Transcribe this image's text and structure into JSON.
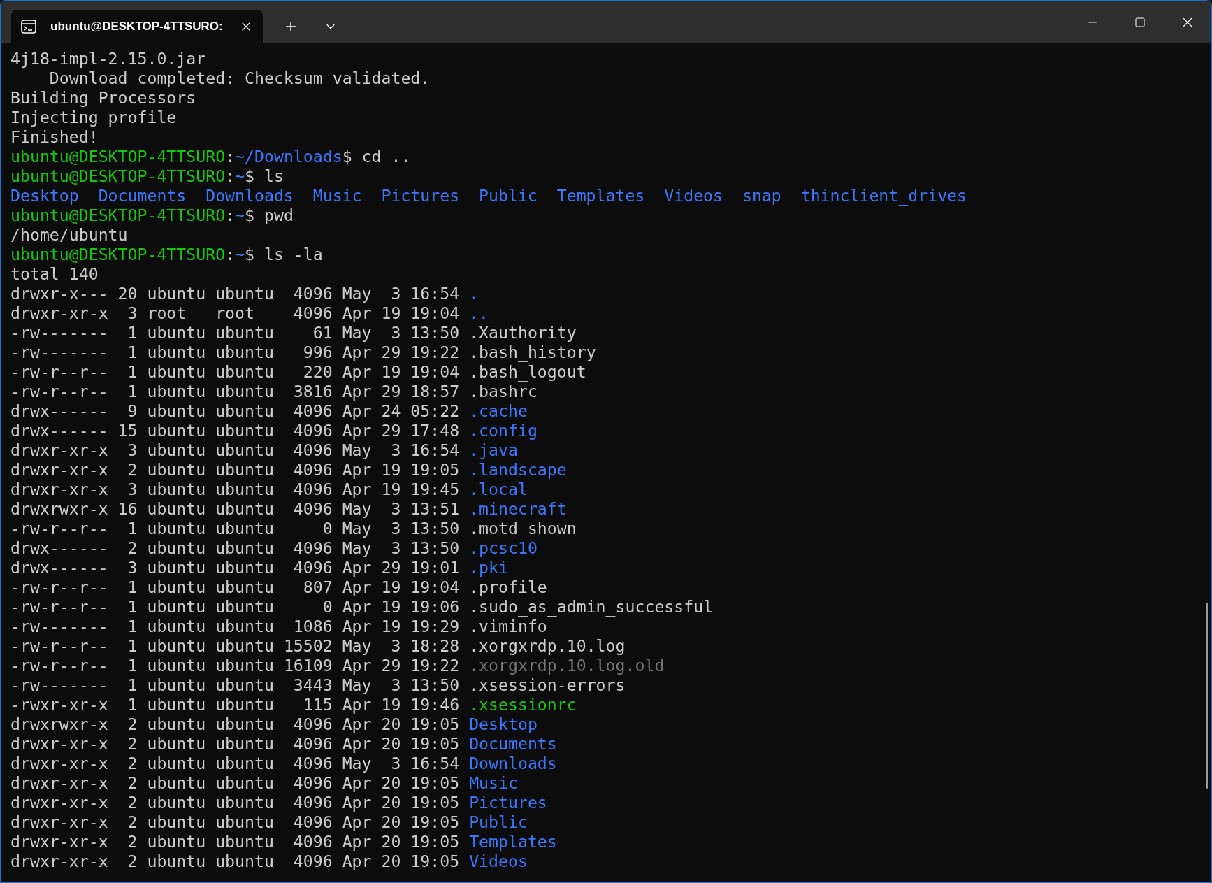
{
  "window": {
    "tabs": [
      {
        "title": "ubuntu@DESKTOP-4TTSURO:",
        "selected": true
      }
    ]
  },
  "terminal": {
    "lines": [
      {
        "kind": "output",
        "text": "4j18-impl-2.15.0.jar"
      },
      {
        "kind": "output",
        "text": "Download completed: Checksum validated.",
        "indented": true
      },
      {
        "kind": "output",
        "text": "Building Processors"
      },
      {
        "kind": "output",
        "text": "Injecting profile"
      },
      {
        "kind": "output",
        "text": "Finished!"
      },
      {
        "kind": "prompt",
        "user": "ubuntu@DESKTOP-4TTSURO",
        "separator": ":",
        "path": "~/Downloads",
        "command": "$ cd .."
      },
      {
        "kind": "prompt",
        "user": "ubuntu@DESKTOP-4TTSURO",
        "separator": ":",
        "path": "~",
        "command": "$ ls"
      },
      {
        "kind": "columns",
        "items": [
          "Desktop",
          "Documents",
          "Downloads",
          "Music",
          "Pictures",
          "Public",
          "Templates",
          "Videos",
          "snap",
          "thinclient_drives"
        ]
      },
      {
        "kind": "prompt",
        "user": "ubuntu@DESKTOP-4TTSURO",
        "separator": ":",
        "path": "~",
        "command": "$ pwd"
      },
      {
        "kind": "output",
        "text": "/home/ubuntu"
      },
      {
        "kind": "prompt",
        "user": "ubuntu@DESKTOP-4TTSURO",
        "separator": ":",
        "path": "~",
        "command": "$ ls -la"
      },
      {
        "kind": "output",
        "text": "total 140"
      },
      {
        "kind": "dir",
        "info": "drwxr-x--- 20 ubuntu ubuntu  4096 May  3 16:54",
        "name": "."
      },
      {
        "kind": "dir",
        "info": "drwxr-xr-x  3 root   root    4096 Apr 19 19:04",
        "name": ".."
      },
      {
        "kind": "file",
        "info": "-rw-------  1 ubuntu ubuntu    61 May  3 13:50",
        "name": ".Xauthority"
      },
      {
        "kind": "file",
        "info": "-rw-------  1 ubuntu ubuntu   996 Apr 29 19:22",
        "name": ".bash_history"
      },
      {
        "kind": "file",
        "info": "-rw-r--r--  1 ubuntu ubuntu   220 Apr 19 19:04",
        "name": ".bash_logout"
      },
      {
        "kind": "file",
        "info": "-rw-r--r--  1 ubuntu ubuntu  3816 Apr 29 18:57",
        "name": ".bashrc"
      },
      {
        "kind": "dir",
        "info": "drwx------  9 ubuntu ubuntu  4096 Apr 24 05:22",
        "name": ".cache"
      },
      {
        "kind": "dir",
        "info": "drwx------ 15 ubuntu ubuntu  4096 Apr 29 17:48",
        "name": ".config"
      },
      {
        "kind": "dir",
        "info": "drwxr-xr-x  3 ubuntu ubuntu  4096 May  3 16:54",
        "name": ".java"
      },
      {
        "kind": "dir",
        "info": "drwxr-xr-x  2 ubuntu ubuntu  4096 Apr 19 19:05",
        "name": ".landscape"
      },
      {
        "kind": "dir",
        "info": "drwxr-xr-x  3 ubuntu ubuntu  4096 Apr 19 19:45",
        "name": ".local"
      },
      {
        "kind": "dir",
        "info": "drwxrwxr-x 16 ubuntu ubuntu  4096 May  3 13:51",
        "name": ".minecraft"
      },
      {
        "kind": "file",
        "info": "-rw-r--r--  1 ubuntu ubuntu     0 May  3 13:50",
        "name": ".motd_shown"
      },
      {
        "kind": "dir",
        "info": "drwx------  2 ubuntu ubuntu  4096 May  3 13:50",
        "name": ".pcsc10"
      },
      {
        "kind": "dir",
        "info": "drwx------  3 ubuntu ubuntu  4096 Apr 29 19:01",
        "name": ".pki"
      },
      {
        "kind": "file",
        "info": "-rw-r--r--  1 ubuntu ubuntu   807 Apr 19 19:04",
        "name": ".profile"
      },
      {
        "kind": "file",
        "info": "-rw-r--r--  1 ubuntu ubuntu     0 Apr 19 19:06",
        "name": ".sudo_as_admin_successful"
      },
      {
        "kind": "file",
        "info": "-rw-------  1 ubuntu ubuntu  1086 Apr 19 19:29",
        "name": ".viminfo"
      },
      {
        "kind": "file",
        "info": "-rw-r--r--  1 ubuntu ubuntu 15502 May  3 18:28",
        "name": ".xorgxrdp.10.log"
      },
      {
        "kind": "old",
        "info": "-rw-r--r--  1 ubuntu ubuntu 16109 Apr 29 19:22",
        "name": ".xorgxrdp.10.log.old"
      },
      {
        "kind": "file",
        "info": "-rw-------  1 ubuntu ubuntu  3443 May  3 13:50",
        "name": ".xsession-errors"
      },
      {
        "kind": "exec",
        "info": "-rwxr-xr-x  1 ubuntu ubuntu   115 Apr 19 19:46",
        "name": ".xsessionrc"
      },
      {
        "kind": "dir",
        "info": "drwxrwxr-x  2 ubuntu ubuntu  4096 Apr 20 19:05",
        "name": "Desktop"
      },
      {
        "kind": "dir",
        "info": "drwxr-xr-x  2 ubuntu ubuntu  4096 Apr 20 19:05",
        "name": "Documents"
      },
      {
        "kind": "dir",
        "info": "drwxr-xr-x  2 ubuntu ubuntu  4096 May  3 16:54",
        "name": "Downloads"
      },
      {
        "kind": "dir",
        "info": "drwxr-xr-x  2 ubuntu ubuntu  4096 Apr 20 19:05",
        "name": "Music"
      },
      {
        "kind": "dir",
        "info": "drwxr-xr-x  2 ubuntu ubuntu  4096 Apr 20 19:05",
        "name": "Pictures"
      },
      {
        "kind": "dir",
        "info": "drwxr-xr-x  2 ubuntu ubuntu  4096 Apr 20 19:05",
        "name": "Public"
      },
      {
        "kind": "dir",
        "info": "drwxr-xr-x  2 ubuntu ubuntu  4096 Apr 20 19:05",
        "name": "Templates"
      },
      {
        "kind": "dir",
        "info": "drwxr-xr-x  2 ubuntu ubuntu  4096 Apr 20 19:05",
        "name": "Videos"
      }
    ]
  }
}
